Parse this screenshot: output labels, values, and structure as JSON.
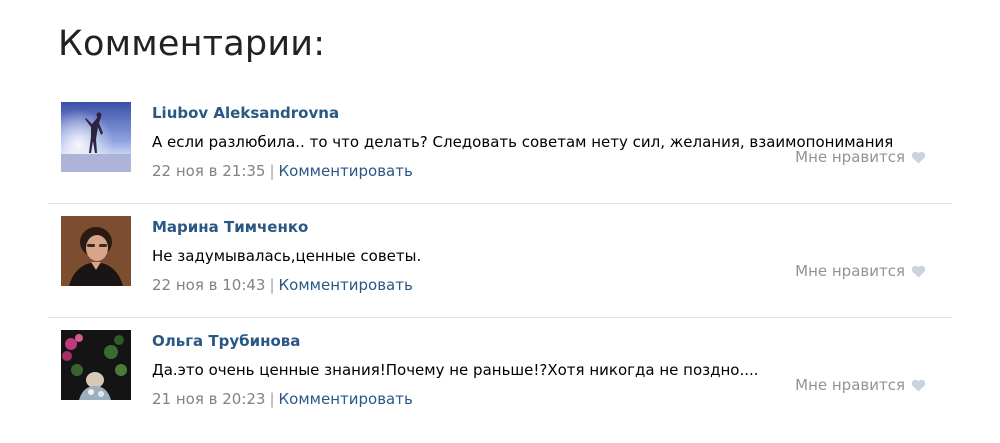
{
  "page": {
    "title": "Комментарии:"
  },
  "comments": [
    {
      "author": "Liubov Aleksandrovna",
      "text": "А если разлюбила.. то что делать? Следовать советам нету сил, желания, взаимопонимания",
      "date": "22 ноя в 21:35",
      "separator": "|",
      "reply_label": "Комментировать",
      "like_label": "Мне нравится",
      "like_icon": "heart-icon"
    },
    {
      "author": "Марина Тимченко",
      "text": "Не задумывалась,ценные советы.",
      "date": "22 ноя в 10:43",
      "separator": "|",
      "reply_label": "Комментировать",
      "like_label": "Мне нравится",
      "like_icon": "heart-icon"
    },
    {
      "author": "Ольга Трубинова",
      "text": "Да.это очень ценные знания!Почему не раньше!?Хотя никогда не поздно....",
      "date": "21 ноя в 20:23",
      "separator": "|",
      "reply_label": "Комментировать",
      "like_label": "Мне нравится",
      "like_icon": "heart-icon"
    }
  ],
  "colors": {
    "link": "#2a5885",
    "meta": "#828282",
    "like": "#939393",
    "heart": "#c9d4e0",
    "divider": "#e1e5ea"
  }
}
